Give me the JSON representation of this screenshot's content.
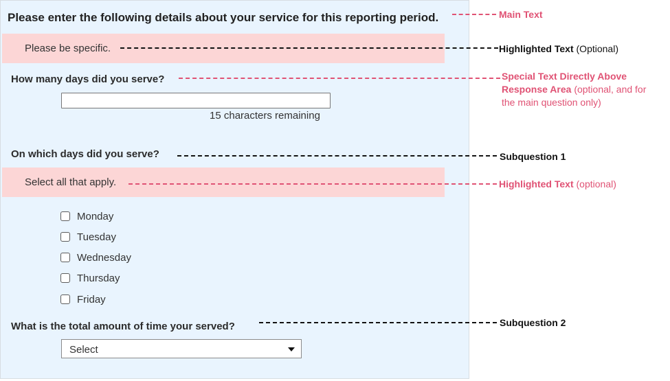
{
  "form": {
    "main_text": "Please enter the following details about your service for this reporting period.",
    "highlight_1": "Please be specific.",
    "question_1": "How many days did you serve?",
    "text_input_value": "",
    "characters_remaining": "15 characters remaining",
    "subquestion_1": "On which days did you serve?",
    "highlight_2": "Select all that apply.",
    "days": [
      {
        "label": "Monday",
        "checked": false
      },
      {
        "label": "Tuesday",
        "checked": false
      },
      {
        "label": "Wednesday",
        "checked": false
      },
      {
        "label": "Thursday",
        "checked": false
      },
      {
        "label": "Friday",
        "checked": false
      }
    ],
    "subquestion_2": "What is the total amount of time your served?",
    "select_value": "Select"
  },
  "annotations": {
    "main_text": "Main Text",
    "highlighted_text_1": "Highlighted Text",
    "highlighted_text_1_opt": "(Optional)",
    "special_text_line1": "Special Text Directly Above",
    "special_text_line2": "Response Area",
    "special_text_line2_opt": "(optional, and for",
    "special_text_line3": "the main question only)",
    "subquestion_1": "Subquestion 1",
    "highlighted_text_2": "Highlighted Text",
    "highlighted_text_2_opt": "(optional)",
    "subquestion_2": "Subquestion 2"
  },
  "colors": {
    "panel_background": "#e9f4fe",
    "highlight_background": "#fcd6d6",
    "annotation_red": "#e05274",
    "annotation_black": "#111111"
  }
}
